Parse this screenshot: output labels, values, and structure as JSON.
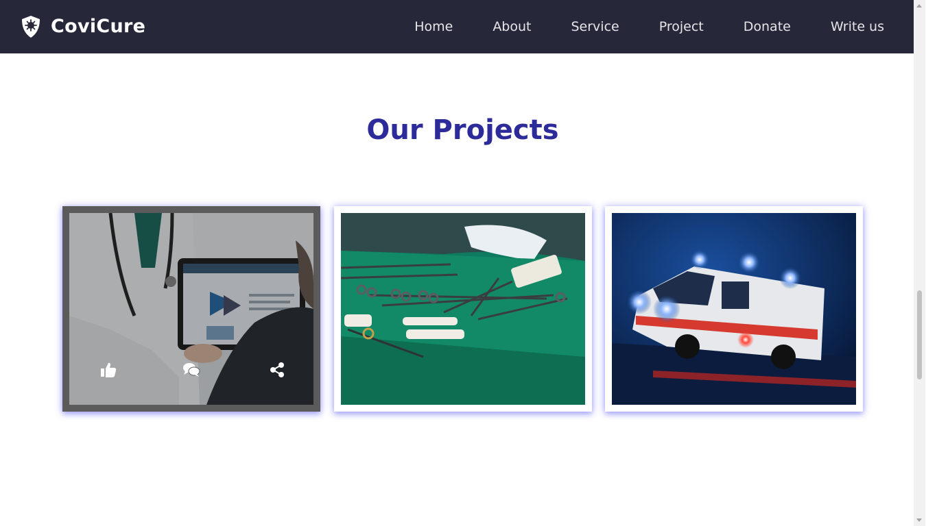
{
  "brand": {
    "name": "CoviCure",
    "icon": "shield-virus-icon"
  },
  "nav": {
    "items": [
      "Home",
      "About",
      "Service",
      "Project",
      "Donate",
      "Write us"
    ]
  },
  "projects": {
    "title": "Our Projects",
    "cards": [
      {
        "image": "doctor-with-tablet-photo",
        "actions": [
          "thumbs-up-icon",
          "comments-icon",
          "share-icon"
        ]
      },
      {
        "image": "surgical-instruments-photo"
      },
      {
        "image": "ambulance-night-photo"
      }
    ]
  },
  "colors": {
    "navbar_bg": "#27273a",
    "title": "#2d2a9a",
    "card_glow": "#6e6eff"
  }
}
